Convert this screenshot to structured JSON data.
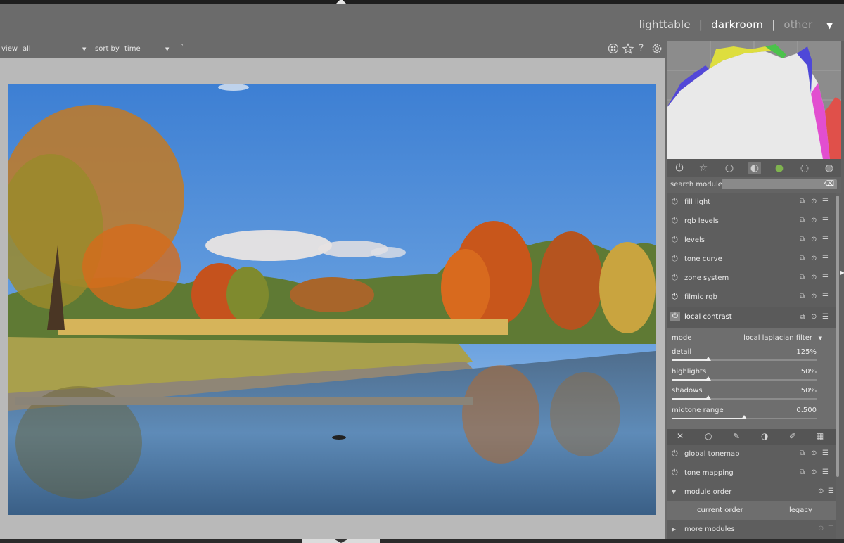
{
  "header": {
    "views": [
      "lighttable",
      "darkroom",
      "other"
    ],
    "active_view": "darkroom"
  },
  "filterbar": {
    "view_label": "view",
    "view_value": "all",
    "sort_label": "sort by",
    "sort_value": "time",
    "sort_dir": "˄"
  },
  "icons": {
    "presets": "presets-icon",
    "star": "star-icon",
    "help": "help-icon",
    "settings": "gear-icon"
  },
  "colors": {
    "panel": "#616161",
    "center_bg": "#b9b9b9",
    "accent": "#ffffff"
  },
  "search": {
    "label": "search module",
    "placeholder": ""
  },
  "modules": [
    {
      "name": "fill light"
    },
    {
      "name": "rgb levels"
    },
    {
      "name": "levels"
    },
    {
      "name": "tone curve"
    },
    {
      "name": "zone system"
    },
    {
      "name": "filmic rgb"
    },
    {
      "name": "local contrast",
      "expanded": true
    }
  ],
  "local_contrast": {
    "mode_label": "mode",
    "mode_value": "local laplacian filter",
    "params": [
      {
        "label": "detail",
        "value": "125%",
        "level": 0.25
      },
      {
        "label": "highlights",
        "value": "50%",
        "level": 0.25
      },
      {
        "label": "shadows",
        "value": "50%",
        "level": 0.25
      },
      {
        "label": "midtone range",
        "value": "0.500",
        "level": 0.5
      }
    ]
  },
  "modules_after": [
    {
      "name": "global tonemap"
    },
    {
      "name": "tone mapping"
    }
  ],
  "module_order": {
    "label": "module order",
    "current": "current order",
    "legacy": "legacy"
  },
  "more_modules": "more modules"
}
